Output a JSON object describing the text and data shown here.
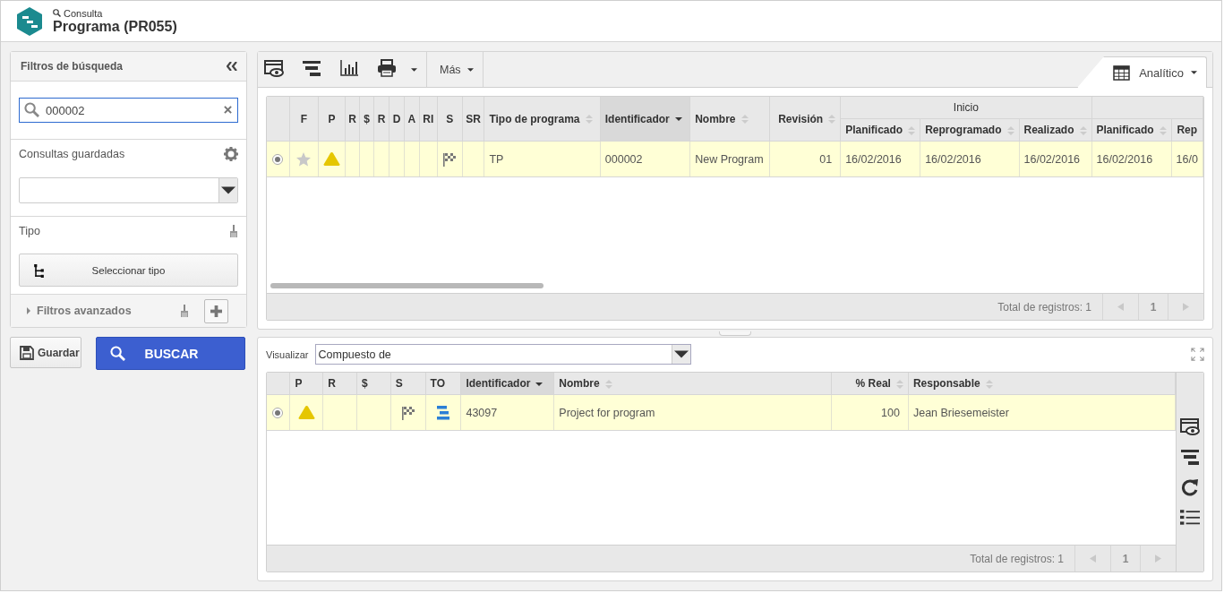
{
  "header": {
    "breadcrumb": "Consulta",
    "title": "Programa (PR055)"
  },
  "filters": {
    "title": "Filtros de búsqueda",
    "search": {
      "value": "000002"
    },
    "saved_queries": {
      "label": "Consultas guardadas"
    },
    "type": {
      "label": "Tipo",
      "button": "Seleccionar tipo"
    },
    "advanced": {
      "label": "Filtros avanzados",
      "expanded": false
    }
  },
  "actions": {
    "save": "Guardar",
    "search": "BUSCAR"
  },
  "main": {
    "toolbar": {
      "more": "Más",
      "view_tab": "Analítico"
    },
    "table": {
      "columns": [
        {
          "label": "F"
        },
        {
          "label": "P"
        },
        {
          "label": "R"
        },
        {
          "label": "$"
        },
        {
          "label": "R"
        },
        {
          "label": "D"
        },
        {
          "label": "A"
        },
        {
          "label": "RI"
        },
        {
          "label": "S"
        },
        {
          "label": "SR"
        },
        {
          "label": "Tipo de programa",
          "sortable": true,
          "sorted": false
        },
        {
          "label": "Identificador",
          "sortable": true,
          "sorted": true
        },
        {
          "label": "Nombre",
          "sortable": true,
          "sorted": false
        },
        {
          "label": "Revisión",
          "sortable": true,
          "sorted": false
        },
        {
          "label": "Inicio",
          "colspan": 3,
          "children": [
            {
              "label": "Planificado",
              "sortable": true,
              "sorted": false
            },
            {
              "label": "Reprogramado",
              "sortable": true,
              "sorted": false
            },
            {
              "label": "Realizado",
              "sortable": true,
              "sorted": false
            }
          ]
        },
        {
          "children": [
            {
              "label": "Planificado",
              "sortable": true,
              "sorted": false
            },
            {
              "label": "Rep"
            }
          ]
        }
      ],
      "rows": [
        {
          "selected": true,
          "cells": [
            {
              "kind": "star"
            },
            {
              "kind": "warning"
            },
            {
              "kind": "empty"
            },
            {
              "kind": "empty"
            },
            {
              "kind": "empty"
            },
            {
              "kind": "empty"
            },
            {
              "kind": "empty"
            },
            {
              "kind": "empty"
            },
            {
              "kind": "flag"
            },
            {
              "kind": "empty"
            },
            {
              "kind": "text",
              "text": "TP"
            },
            {
              "kind": "text",
              "text": "000002"
            },
            {
              "kind": "text",
              "text": "New Program"
            },
            {
              "kind": "number",
              "text": "01"
            },
            {
              "kind": "text",
              "text": "16/02/2016"
            },
            {
              "kind": "text",
              "text": "16/02/2016"
            },
            {
              "kind": "text",
              "text": "16/02/2016"
            },
            {
              "kind": "text",
              "text": "16/02/2016"
            },
            {
              "kind": "text",
              "text": "16/0"
            }
          ]
        }
      ],
      "footer": {
        "total": "Total de registros: 1",
        "page": "1"
      }
    }
  },
  "detail": {
    "view_label": "Visualizar",
    "view_value": "Compuesto de",
    "table": {
      "columns": [
        {
          "label": "P"
        },
        {
          "label": "R"
        },
        {
          "label": "$"
        },
        {
          "label": "S"
        },
        {
          "label": "TO"
        },
        {
          "label": "Identificador",
          "sortable": true,
          "sorted": true
        },
        {
          "label": "Nombre",
          "sortable": true,
          "sorted": false
        },
        {
          "label": "% Real",
          "sortable": true,
          "sorted": false
        },
        {
          "label": "Responsable",
          "sortable": true,
          "sorted": false
        }
      ],
      "rows": [
        {
          "selected": true,
          "cells": [
            {
              "kind": "warning"
            },
            {
              "kind": "empty"
            },
            {
              "kind": "empty"
            },
            {
              "kind": "flag"
            },
            {
              "kind": "gantt"
            },
            {
              "kind": "text",
              "text": "43097"
            },
            {
              "kind": "text",
              "text": "Project for program"
            },
            {
              "kind": "number",
              "text": "100"
            },
            {
              "kind": "text",
              "text": "Jean Briesemeister"
            }
          ]
        }
      ],
      "footer": {
        "total": "Total de registros: 1",
        "page": "1"
      }
    }
  }
}
